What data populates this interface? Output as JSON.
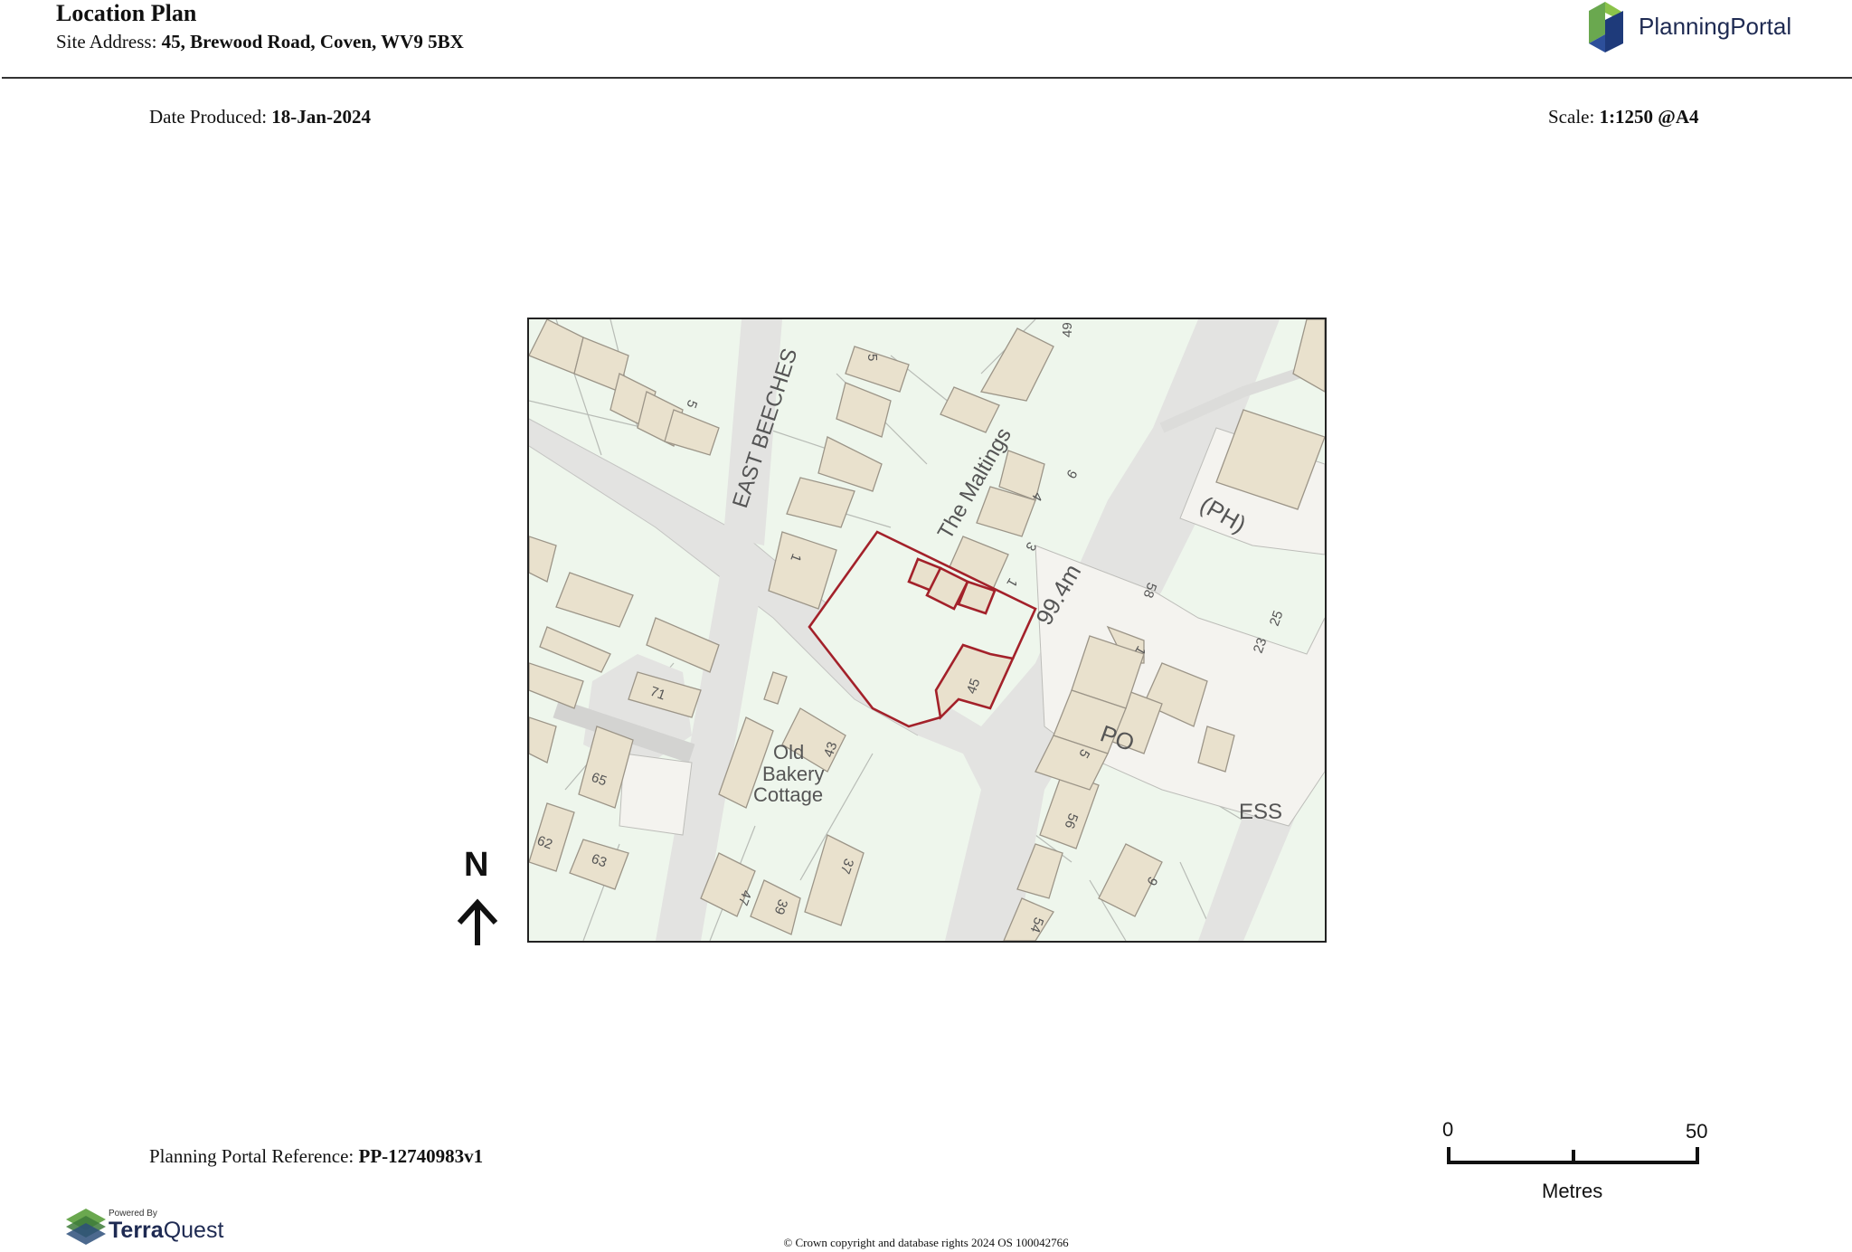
{
  "header": {
    "title": "Location Plan",
    "site_address_label": "Site Address:",
    "site_address": "45, Brewood Road, Coven, WV9 5BX",
    "logo_text": "PlanningPortal"
  },
  "meta": {
    "date_label": "Date Produced:",
    "date": "18-Jan-2024",
    "scale_label": "Scale:",
    "scale": "1:1250 @A4",
    "reference_label": "Planning Portal Reference:",
    "reference": "PP-12740983v1"
  },
  "map": {
    "labels": {
      "east_beeches": "EAST BEECHES",
      "the_maltings": "The Maltings",
      "spot_height": "99.4m",
      "ph": "(PH)",
      "po": "PO",
      "ess": "ESS",
      "old": "Old",
      "bakery": "Bakery",
      "cottage": "Cottage",
      "n49": "49",
      "n5a": "5",
      "n5b": "5",
      "n9a": "9",
      "n4": "4",
      "n3": "3",
      "n1a": "1",
      "n1b": "1",
      "n45": "45",
      "n58": "58",
      "n25": "25",
      "n23": "23",
      "n1c": "1",
      "n5c": "5",
      "n71": "71",
      "n65": "65",
      "n43": "43",
      "n56": "56",
      "n62": "62",
      "n63": "63",
      "n47": "47",
      "n39": "39",
      "n37": "37",
      "n54": "54",
      "n9b": "9"
    }
  },
  "north_arrow": {
    "label": "N"
  },
  "scale_bar": {
    "start": "0",
    "end": "50",
    "units": "Metres"
  },
  "footer": {
    "powered_by": "Powered By",
    "provider_a": "Terra",
    "provider_b": "Quest",
    "copyright": "© Crown copyright and database rights 2024 OS 100042766"
  },
  "colors": {
    "site_boundary": "#a3212a",
    "building_fill": "#e9e1cd",
    "road_fill": "#e3e3e1",
    "land_fill": "#eef6ec",
    "logo_green": "#6aa84f",
    "logo_blue": "#1e3a7a"
  }
}
